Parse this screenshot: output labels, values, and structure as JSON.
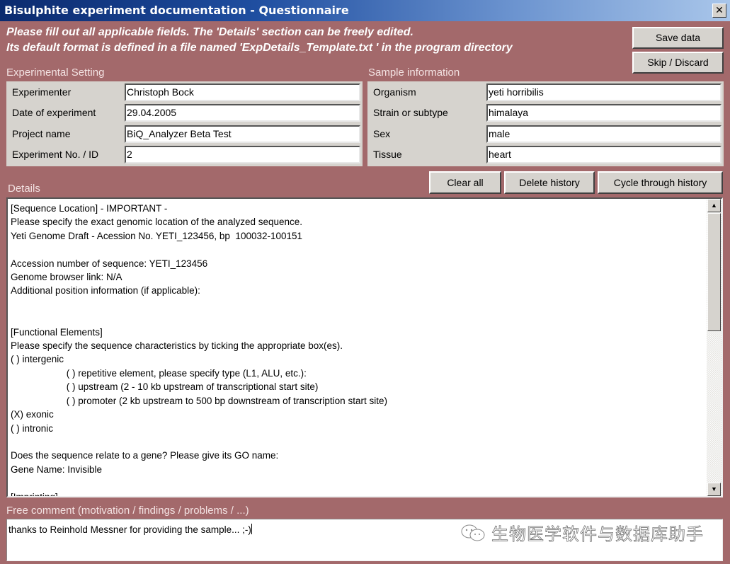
{
  "window": {
    "title": "Bisulphite experiment documentation - Questionnaire",
    "close_icon": "close-icon (×)"
  },
  "intro": {
    "line1": "Please fill out all applicable fields. The 'Details' section can be freely edited.",
    "line2": "Its default format is defined in a file named 'ExpDetails_Template.txt ' in the program directory"
  },
  "buttons": {
    "save": "Save data",
    "skip": "Skip / Discard",
    "clear": "Clear all",
    "delete_history": "Delete history",
    "cycle_history": "Cycle through history"
  },
  "experimental_setting": {
    "title": "Experimental Setting",
    "fields": [
      {
        "label": "Experimenter",
        "value": "Christoph Bock"
      },
      {
        "label": "Date of experiment",
        "value": "29.04.2005"
      },
      {
        "label": "Project name",
        "value": "BiQ_Analyzer Beta Test"
      },
      {
        "label": "Experiment No. / ID",
        "value": "2"
      }
    ]
  },
  "sample_information": {
    "title": "Sample information",
    "fields": [
      {
        "label": "Organism",
        "value": "yeti horribilis"
      },
      {
        "label": "Strain or subtype",
        "value": "himalaya"
      },
      {
        "label": "Sex",
        "value": "male"
      },
      {
        "label": "Tissue",
        "value": "heart"
      }
    ]
  },
  "details": {
    "title": "Details",
    "text": "[Sequence Location] - IMPORTANT -\nPlease specify the exact genomic location of the analyzed sequence.\nYeti Genome Draft - Acession No. YETI_123456, bp  100032-100151\n\nAccession number of sequence: YETI_123456\nGenome browser link: N/A\nAdditional position information (if applicable):\n\n\n[Functional Elements]\nPlease specify the sequence characteristics by ticking the appropriate box(es).\n( ) intergenic\n                     ( ) repetitive element, please specify type (L1, ALU, etc.):\n                     ( ) upstream (2 - 10 kb upstream of transcriptional start site)\n                     ( ) promoter (2 kb upstream to 500 bp downstream of transcription start site)\n(X) exonic\n( ) intronic\n\nDoes the sequence relate to a gene? Please give its GO name:\nGene Name: Invisible\n\n[Imprinting]",
    "scroll_up_icon": "▲",
    "scroll_down_icon": "▼"
  },
  "free_comment": {
    "title": "Free comment (motivation / findings / problems / ...)",
    "value": "thanks to Reinhold Messner for providing the sample... ;-)"
  },
  "watermark": {
    "text": "生物医学软件与数据库助手"
  }
}
